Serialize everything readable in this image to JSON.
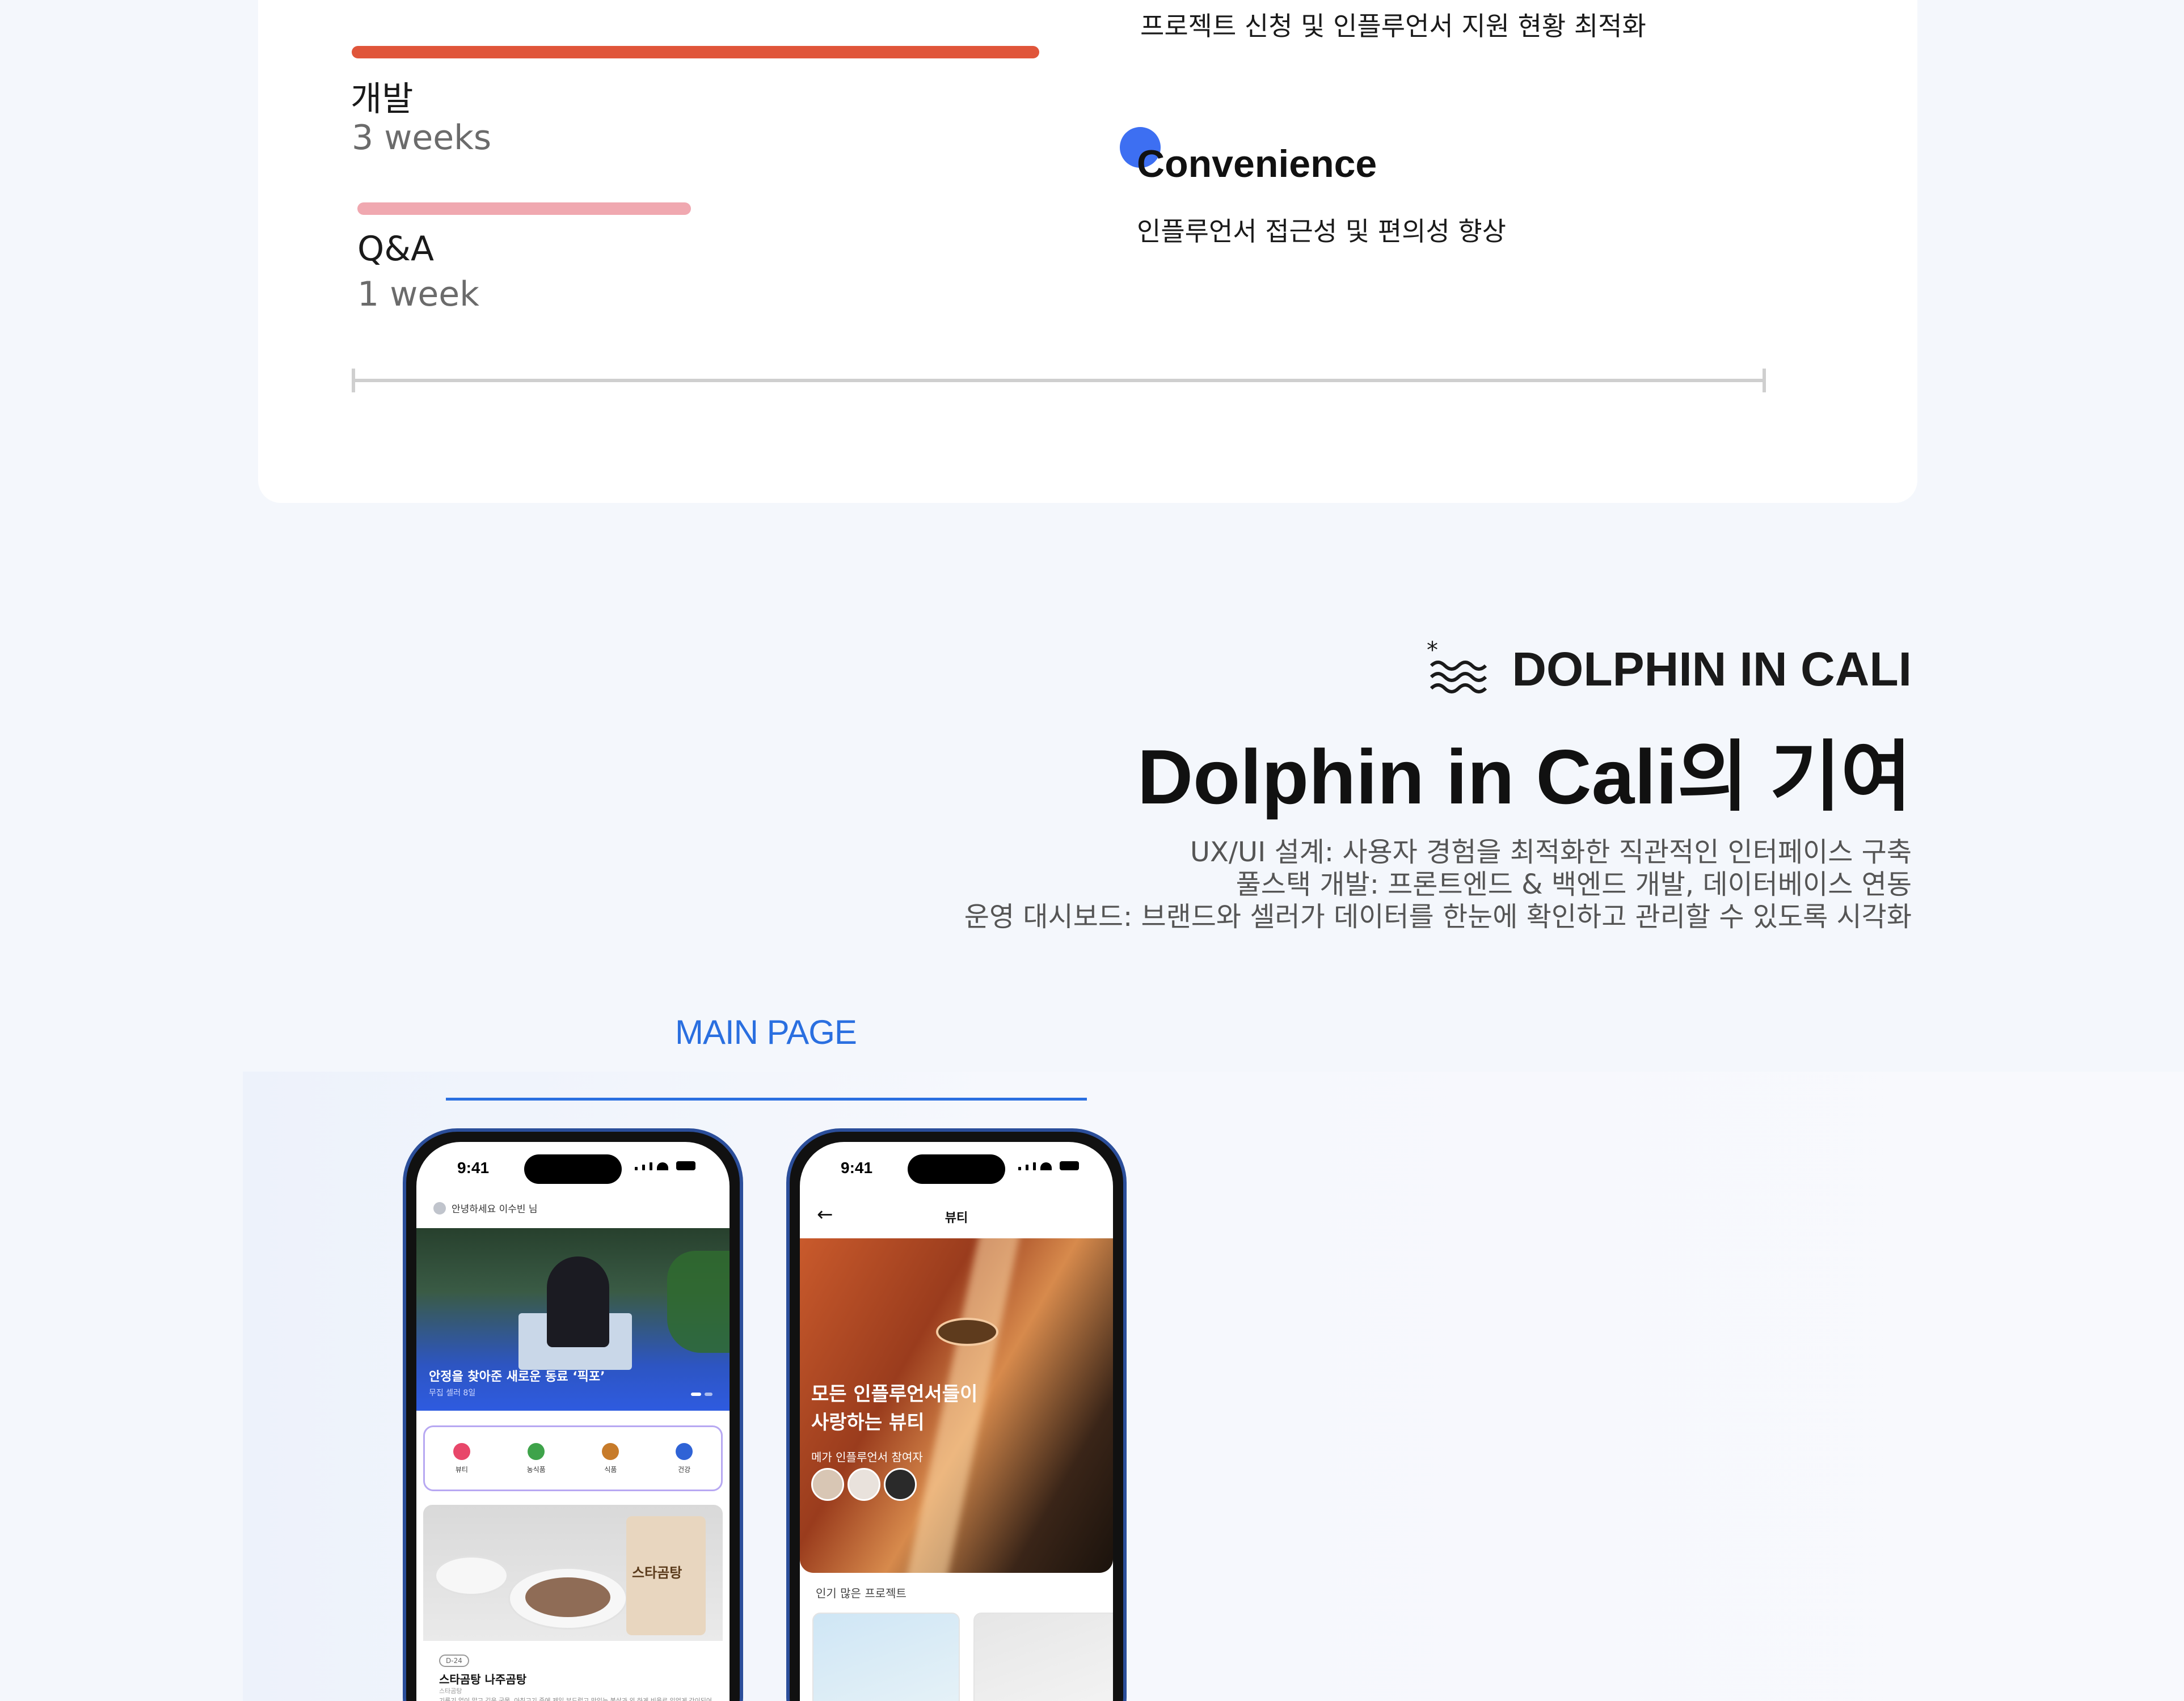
{
  "timeline": {
    "phases": [
      {
        "name": "개발",
        "duration": "3 weeks",
        "color": "#e0553a"
      },
      {
        "name": "Q&A",
        "duration": "1 week",
        "color": "#f0a8b0"
      }
    ]
  },
  "goals": {
    "top_text": "프로젝트 신청 및 인플루언서 지원 현황 최적화",
    "convenience_title": "Convenience",
    "convenience_text": "인플루언서 접근성 및 편의성 향상",
    "dot_color": "#3d6ff2"
  },
  "contribution": {
    "brand": "DOLPHIN IN CALI",
    "brand_icon": "dolphin-waves-icon",
    "title": "Dolphin in Cali의 기여",
    "lines": [
      "UX/UI 설계: 사용자 경험을 최적화한 직관적인 인터페이스 구축",
      "풀스택 개발: 프론트엔드 & 백엔드 개발, 데이터베이스 연동",
      "운영 대시보드: 브랜드와 셀러가 데이터를 한눈에 확인하고 관리할 수 있도록 시각화"
    ],
    "main_page_label": "MAIN PAGE",
    "accent_color": "#2a6fe0"
  },
  "phone1": {
    "time": "9:41",
    "greeting": "안녕하세요 이수빈 님",
    "hero_caption": "안정을 찾아준 새로운 동료 ‘픽포’",
    "hero_sub": "무집 셀러 8일",
    "categories": [
      {
        "label": "뷰티",
        "icon": "lipstick-icon",
        "color": "#e8476a"
      },
      {
        "label": "농식품",
        "icon": "sprout-icon",
        "color": "#3ea34a"
      },
      {
        "label": "식품",
        "icon": "food-icon",
        "color": "#c77b2a"
      },
      {
        "label": "건강",
        "icon": "dumbbell-icon",
        "color": "#2f63d6"
      }
    ],
    "pouch_text": "스타곰탕",
    "product_tag": "D-24",
    "product_title": "스타곰탕 나주곰탕",
    "product_small": "스타곰탕",
    "product_desc": "기름기 없이 맑고 깊은 국물, 아침고기 중에 제일 부드럽고 맛있는 불살과 외 하게 비율로 있었게 간이되어 있는~"
  },
  "phone2": {
    "time": "9:41",
    "title": "뷰티",
    "hero_caption_1": "모든 인플루언서들이",
    "hero_caption_2": "사랑하는 뷰티",
    "participants_label": "메가 인플루언서 참여자",
    "popular_label": "인기 많은 프로젝트"
  }
}
